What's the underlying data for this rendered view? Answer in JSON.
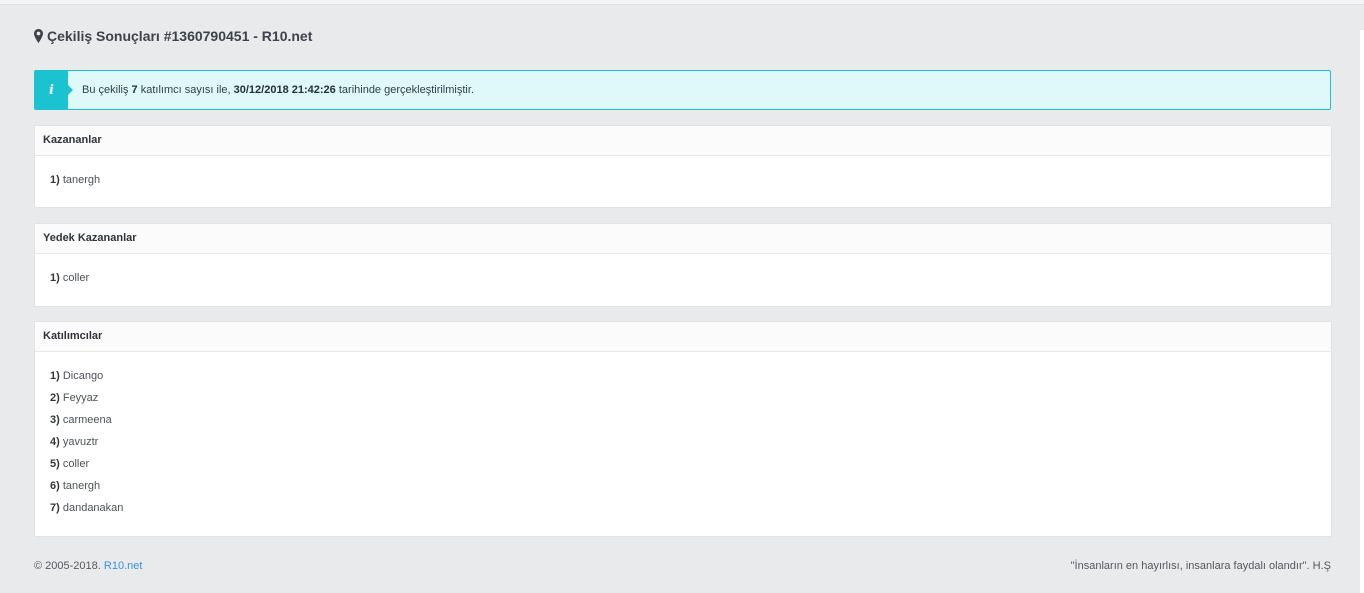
{
  "header": {
    "title": "Çekiliş Sonuçları #1360790451 - R10.net",
    "icon": "map-marker-icon"
  },
  "alert": {
    "icon": "info-icon",
    "icon_glyph": "i",
    "text_1": "Bu çekiliş",
    "participant_count": "7",
    "text_2": "katılımcı sayısı ile,",
    "datetime": "30/12/2018 21:42:26",
    "text_3": "tarihinde gerçekleştirilmiştir.",
    "accent": "#1bc3d1"
  },
  "winners": {
    "title": "Kazananlar",
    "items": [
      {
        "num": "1)",
        "name": "tanergh"
      }
    ]
  },
  "backup_winners": {
    "title": "Yedek Kazananlar",
    "items": [
      {
        "num": "1)",
        "name": "coller"
      }
    ]
  },
  "participants": {
    "title": "Katılımcılar",
    "items": [
      {
        "num": "1)",
        "name": "Dicango"
      },
      {
        "num": "2)",
        "name": "Feyyaz"
      },
      {
        "num": "3)",
        "name": "carmeena"
      },
      {
        "num": "4)",
        "name": "yavuztr"
      },
      {
        "num": "5)",
        "name": "coller"
      },
      {
        "num": "6)",
        "name": "tanergh"
      },
      {
        "num": "7)",
        "name": "dandanakan"
      }
    ]
  },
  "footer": {
    "copyright": "© 2005-2018.",
    "site_link": "R10.net",
    "quote": "\"İnsanların en hayırlısı, insanlara faydalı olandır\". H.Ş"
  }
}
